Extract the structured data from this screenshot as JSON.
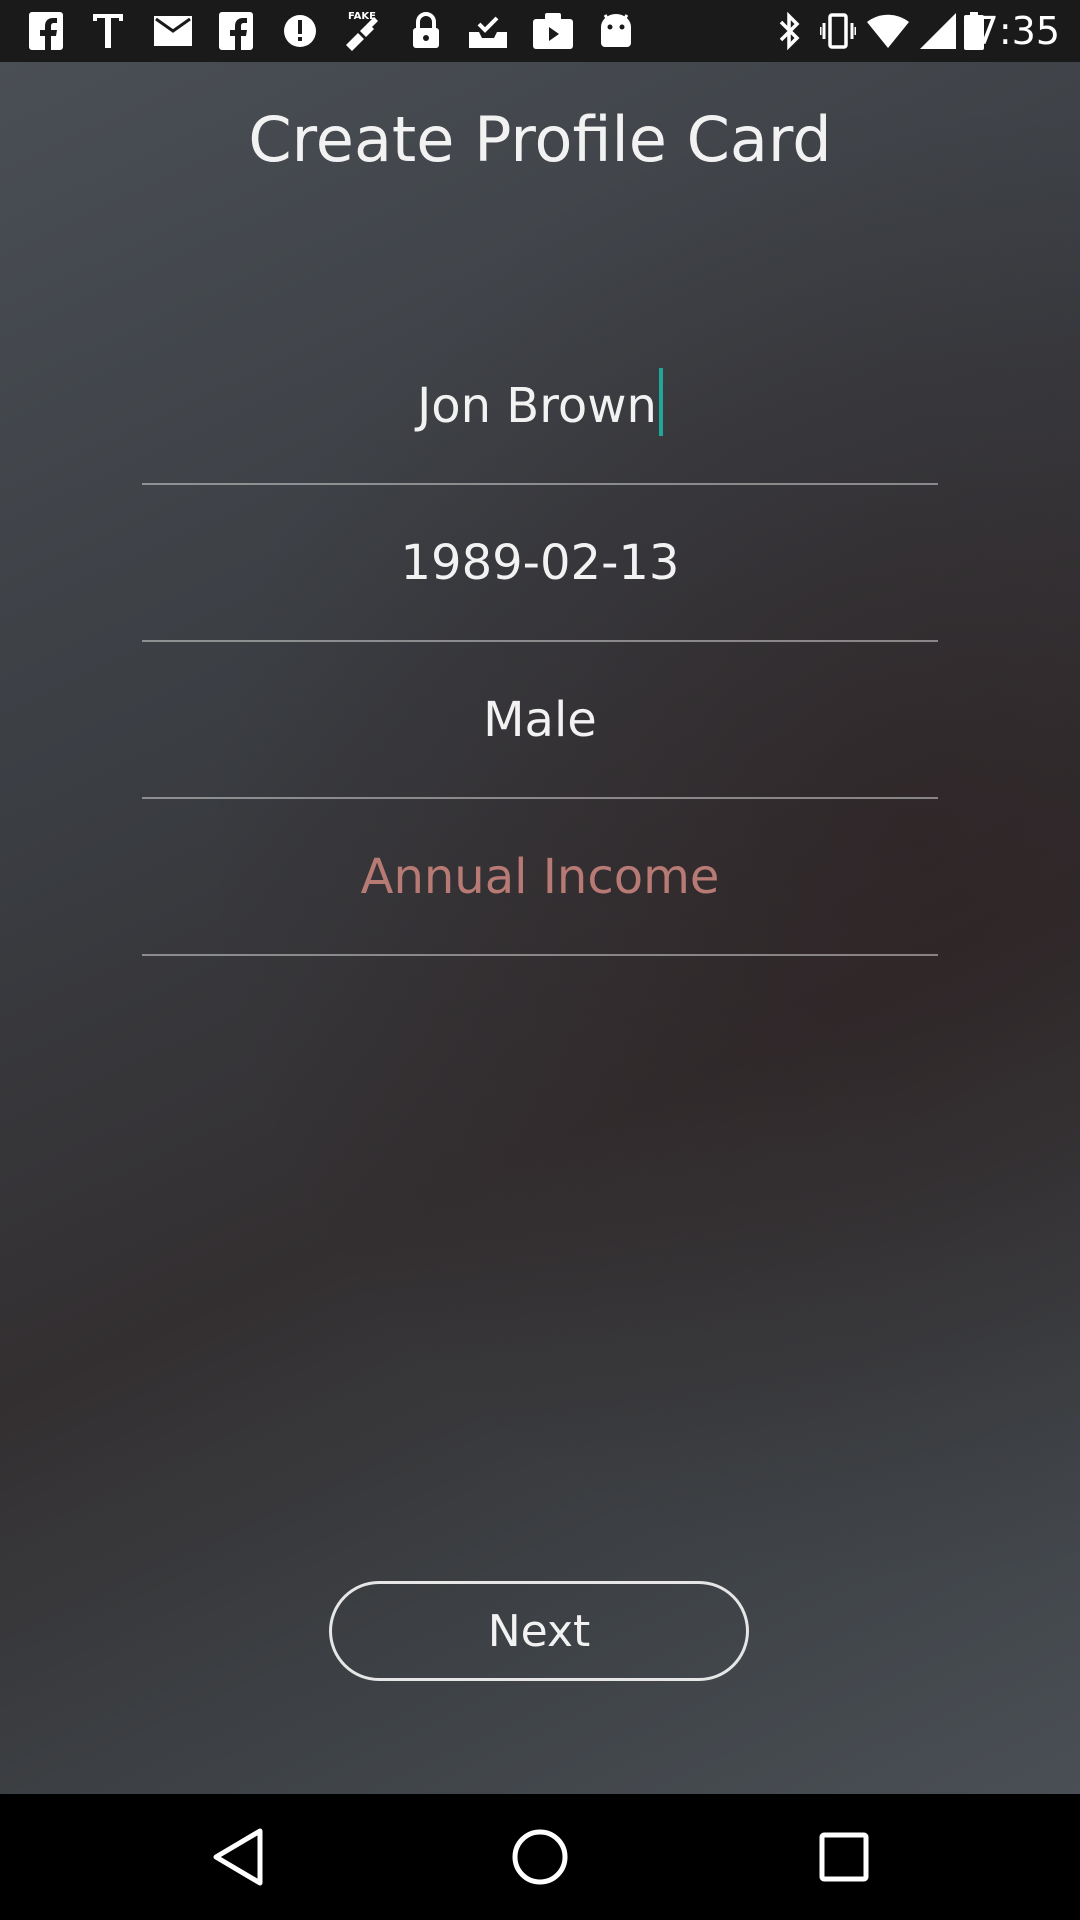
{
  "status_bar": {
    "time": "7:35",
    "icons_left": [
      "facebook-icon",
      "text-icon",
      "mail-icon",
      "facebook-icon",
      "alert-icon",
      "fake-gps-icon",
      "lock-icon",
      "inbox-check-icon",
      "video-play-icon",
      "android-icon"
    ],
    "icons_right": [
      "bluetooth-icon",
      "vibrate-icon",
      "wifi-icon",
      "signal-icon",
      "battery-icon"
    ]
  },
  "header": {
    "title": "Create Profile Card"
  },
  "form": {
    "name_value": "Jon Brown",
    "dob_value": "1989-02-13",
    "gender_value": "Male",
    "income_placeholder": "Annual Income"
  },
  "actions": {
    "next_label": "Next"
  },
  "colors": {
    "cursor": "#1fa79a",
    "placeholder": "#b87a74",
    "text": "#f2f2f2"
  },
  "nav_bar": {
    "buttons": [
      "back-icon",
      "home-icon",
      "recents-icon"
    ]
  }
}
